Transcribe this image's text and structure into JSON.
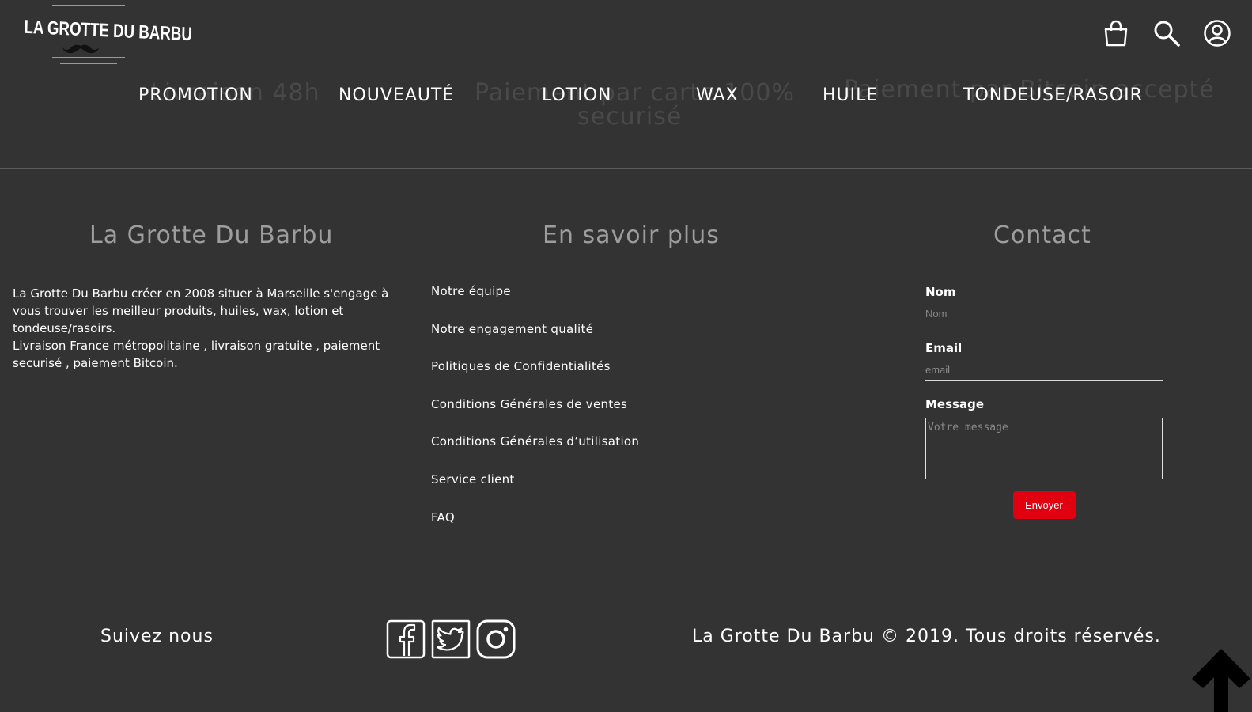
{
  "brand": {
    "logo_text": "LA GROTTE DU BARBU"
  },
  "header": {
    "icons": [
      "shopping-bag-icon",
      "search-icon",
      "user-account-icon"
    ]
  },
  "ghost_banner": {
    "delivery": "Livraison 48h",
    "payment_card": "Paiement par carte 100%",
    "secured": "securisé",
    "bitcoin": "Paiement par Bitcoin accepté"
  },
  "nav": {
    "items": [
      "PROMOTION",
      "NOUVEAUTÉ",
      "LOTION",
      "WAX",
      "HUILE",
      "TONDEUSE/RASOIR"
    ]
  },
  "footer": {
    "about": {
      "title": "La Grotte Du Barbu",
      "paragraph1": "La Grotte Du Barbu créer en 2008 situer à Marseille s'engage à vous trouver les meilleur produits, huiles, wax, lotion et tondeuse/rasoirs.",
      "paragraph2": "Livraison France métropolitaine , livraison gratuite , paiement securisé , paiement Bitcoin."
    },
    "more": {
      "title": "En savoir plus",
      "links": [
        "Notre équipe",
        "Notre engagement qualité",
        "Politiques de Confidentialités",
        "Conditions Générales de ventes",
        "Conditions Générales d’utilisation",
        "Service client",
        "FAQ"
      ]
    },
    "contact": {
      "title": "Contact",
      "name_label": "Nom",
      "name_placeholder": "Nom",
      "email_label": "Email",
      "email_placeholder": "email",
      "message_label": "Message",
      "message_placeholder": "Votre message",
      "submit_label": "Envoyer"
    }
  },
  "bottom": {
    "follow_label": "Suivez nous",
    "socials": [
      "facebook-icon",
      "twitter-icon",
      "instagram-icon"
    ],
    "copyright": "La Grotte Du Barbu © 2019. Tous droits réservés.",
    "back_to_top_icon": "arrow-up-icon"
  },
  "colors": {
    "background": "#333333",
    "text": "#ffffff",
    "title_gray": "#9d9d9d",
    "accent_red": "#e10010"
  }
}
